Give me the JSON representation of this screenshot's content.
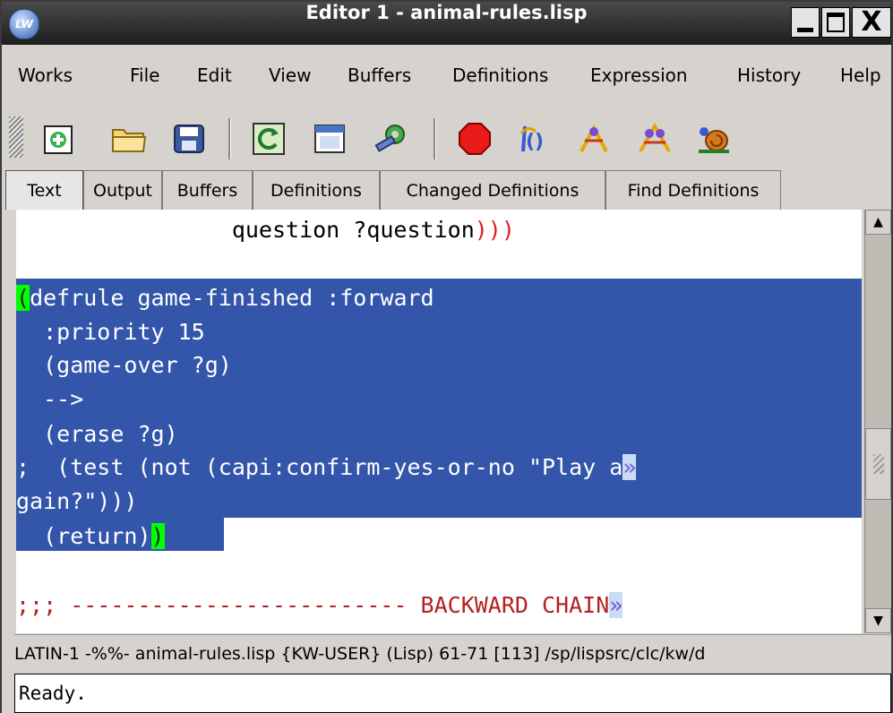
{
  "window": {
    "title": "Editor 1 - animal-rules.lisp",
    "app_icon_label": "LW",
    "close_glyph": "X"
  },
  "menu": [
    "Works",
    "File",
    "Edit",
    "View",
    "Buffers",
    "Definitions",
    "Expression",
    "History",
    "Help"
  ],
  "toolbar": {
    "buttons": [
      "new-file-icon",
      "open-folder-icon",
      "save-disk-icon",
      "refresh-buffer-icon",
      "window-icon",
      "wrench-gear-icon",
      "stop-icon",
      "evaluate-icon",
      "compile-icon",
      "compile-buffer-icon",
      "snail-icon"
    ]
  },
  "tabs": [
    "Text",
    "Output",
    "Buffers",
    "Definitions",
    "Changed Definitions",
    "Find Definitions"
  ],
  "active_tab": "Text",
  "editor": {
    "line1_text": "                question ?question",
    "line1_parens": ")))",
    "rule_open_paren": "(",
    "rule_line1": "defrule game-finished :forward",
    "rule_line2": "  :priority 15",
    "rule_line3": "  (game-over ?g)",
    "rule_line4": "  -->",
    "rule_line5": "  (erase ?g)",
    "rule_line6": ";  (test (not (capi:confirm-yes-or-no \"Play a",
    "rule_line7": "gain?\")))",
    "rule_line8": "  (return)",
    "rule_close_paren": ")",
    "comment_semis": ";;;",
    "comment_dashes": " ------------------------- BACKWARD CHAIN",
    "continuation": "»"
  },
  "colors": {
    "selection": "#3355aa",
    "paren_match": "#00ff00",
    "paren_red": "#e0201a",
    "comment": "#b22222"
  },
  "status": {
    "mode_line": "LATIN-1 -%%- animal-rules.lisp   {KW-USER} (Lisp) 61-71 [113] /sp/lispsrc/clc/kw/d",
    "echo": "Ready."
  }
}
